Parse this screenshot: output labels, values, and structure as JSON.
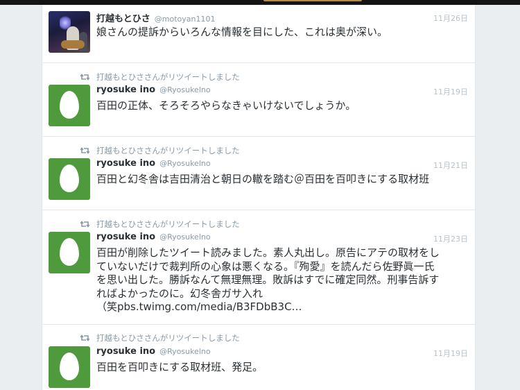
{
  "retweet_notice": "打越もとひささんがリツイートしました",
  "tweets": [
    {
      "name": "打越もとひさ",
      "handle": "@motoyan1101",
      "time": "11月26日",
      "text": "娘さんの提訴からいろんな情報を目にした、これは奥が深い。",
      "avatar": "photo"
    },
    {
      "name": "ryosuke ino",
      "handle": "@Ryosukelno",
      "time": "11月19日",
      "text": "百田の正体、そろそろやらなきゃいけないでしょうか。",
      "avatar": "egg"
    },
    {
      "name": "ryosuke ino",
      "handle": "@Ryosukelno",
      "time": "11月21日",
      "text": "百田と幻冬舎は吉田清治と朝日の轍を踏む＠百田を百叩きにする取材班",
      "avatar": "egg"
    },
    {
      "name": "ryosuke ino",
      "handle": "@Ryosukelno",
      "time": "11月23日",
      "text_lines": [
        "百田が削除したツイート読みました。素人丸出し。原告にアテの取材をし",
        "ていないだけで裁判所の心象は悪くなる。『殉愛』を読んだら佐野眞一氏",
        "を思い出した。勝訴なんて無理無理。敗訴はすでに確定同然。刑事告訴す",
        "ればよかったのに。幻冬舎ガサ入れ",
        "（笑pbs.twimg.com/media/B3FDbB3C…"
      ],
      "avatar": "egg"
    },
    {
      "name": "ryosuke ino",
      "handle": "@Ryosukelno",
      "time": "11月19日",
      "text": "百田を百叩きにする取材班、発足。",
      "avatar": "egg"
    }
  ],
  "colors": {
    "avatar_green": "#4f9a3c",
    "background": "#eaeef1",
    "card": "#ffffff",
    "meta_gray": "#8899a6"
  },
  "icons": {
    "retweet": "retweet-icon",
    "default_avatar": "egg-avatar-icon"
  }
}
